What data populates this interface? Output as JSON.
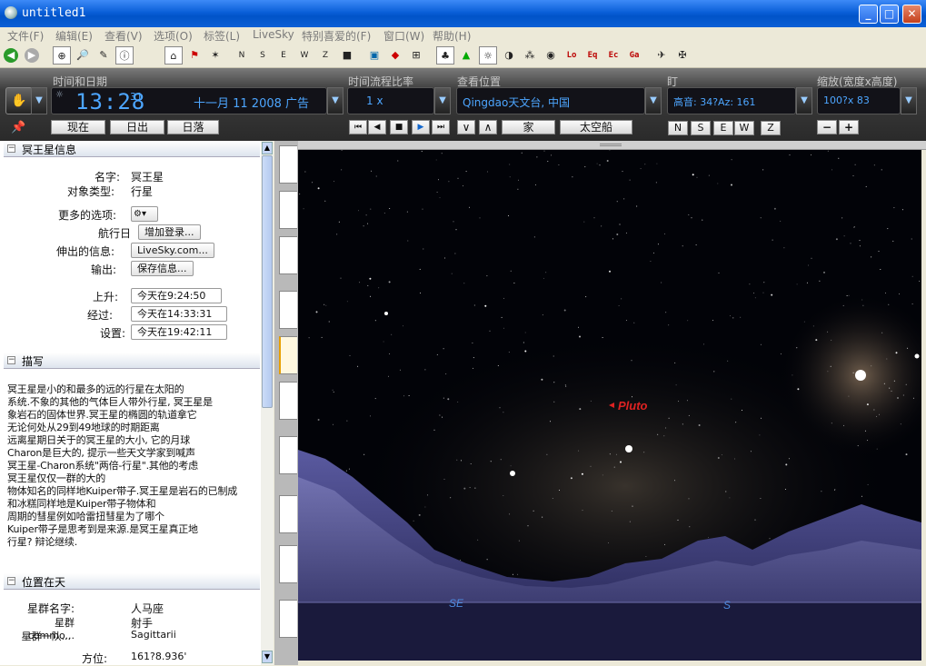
{
  "window": {
    "title": "untitled1",
    "minimize": "_",
    "maximize": "□",
    "close": "✕"
  },
  "menu": [
    "文件(F)",
    "编辑(E)",
    "查看(V)",
    "选项(O)",
    "标签(L)",
    "LiveSky",
    "特别喜爱的(F)",
    "窗口(W)",
    "帮助(H)"
  ],
  "toolbar": {
    "back": "◀",
    "forward": "▶",
    "icons": [
      "⊕",
      "🔎",
      "✎",
      "ⓘ",
      "⌂",
      "⚑",
      "✶",
      "N",
      "S",
      "E",
      "W",
      "Z",
      "■",
      "▣",
      "◆",
      "⊞",
      "♣",
      "▲",
      "☼",
      "◑",
      "⁂",
      "◉"
    ],
    "lo": "Lo",
    "eq": "Eq",
    "ec": "Ec",
    "ga": "Ga",
    "ship": "✈",
    "ship2": "✠"
  },
  "time": {
    "label_datetime": "时间和日期",
    "clock": "13:28",
    "seconds": "31",
    "date": "十一月 11  2008 广告",
    "label_rate": "时间流程比率",
    "rate": "1 x",
    "label_location": "查看位置",
    "location": "Qingdao天文台, 中国",
    "label_direction": "盯",
    "direction": "高音: 34?Az: 161",
    "label_zoom": "缩放(宽度x高度)",
    "zoom": "100?x 83",
    "btn_now": "现在",
    "btn_sunrise": "日出",
    "btn_sunset": "日落",
    "btn_home": "家",
    "btn_spaceship": "太空船",
    "dir_buttons": [
      "N",
      "S",
      "E",
      "W",
      "Z"
    ],
    "zoom_minus": "−",
    "zoom_plus": "+",
    "playback": [
      "⏮",
      "◀",
      "■",
      "▶",
      "⏭"
    ],
    "down": "∨",
    "up": "∧"
  },
  "info": {
    "section_title": "冥王星信息",
    "name_label": "名字:",
    "name_value": "冥王星",
    "type_label": "对象类型:",
    "type_value": "行星",
    "options_label": "更多的选项:",
    "options_btn": "⚙▾",
    "log_label": "航行日",
    "log_btn": "增加登录...",
    "link_label": "伸出的信息:",
    "link_btn": "LiveSky.com...",
    "output_label": "输出:",
    "output_btn": "保存信息...",
    "rise_label": "上升:",
    "rise_value": "今天在9:24:50",
    "transit_label": "经过:",
    "transit_value": "今天在14:33:31",
    "set_label": "设置:",
    "set_value": "今天在19:42:11"
  },
  "description": {
    "section_title": "描写",
    "lines": [
      "冥王星是小的和最多的远的行星在太阳的",
      "系统.不象的其他的气体巨人带外行星, 冥王星是",
      "象岩石的固体世界.冥王星的椭圆的轨道拿它",
      "无论何处从29到49地球的时期距离",
      "远离星期日关于的冥王星的大小, 它的月球",
      "Charon是巨大的, 提示一些天文学家到喊声",
      "冥王星-Charon系统\"两倍-行星\".其他的考虑",
      "冥王星仅仅一群的大的",
      "物体知名的同样地Kuiper带子.冥王星是岩石的已制成",
      "和冰糕同样地是Kuiper带子物体和",
      "周期的彗星例如哈雷扭彗星为了哪个",
      "Kuiper带子是思考到是来源.是冥王星真正地",
      "行星? 辩论继续."
    ]
  },
  "position": {
    "section_title": "位置在天",
    "constellation_label": "星群名字:",
    "constellation_value": "人马座",
    "common_label": "星群commo...",
    "common_value": "射手",
    "abbr_label": "星群一队...",
    "abbr_value": "Sagittarii",
    "azimuth_label": "方位:",
    "azimuth_value": "161?8.936'"
  },
  "sky": {
    "object_label": "Pluto",
    "horizon_se": "SE",
    "horizon_s": "S"
  },
  "colors": {
    "accent": "#0a5fd8",
    "sky_label": "#dd2222",
    "horizon_text": "#4d8be0",
    "lcd_text": "#55aaff"
  }
}
